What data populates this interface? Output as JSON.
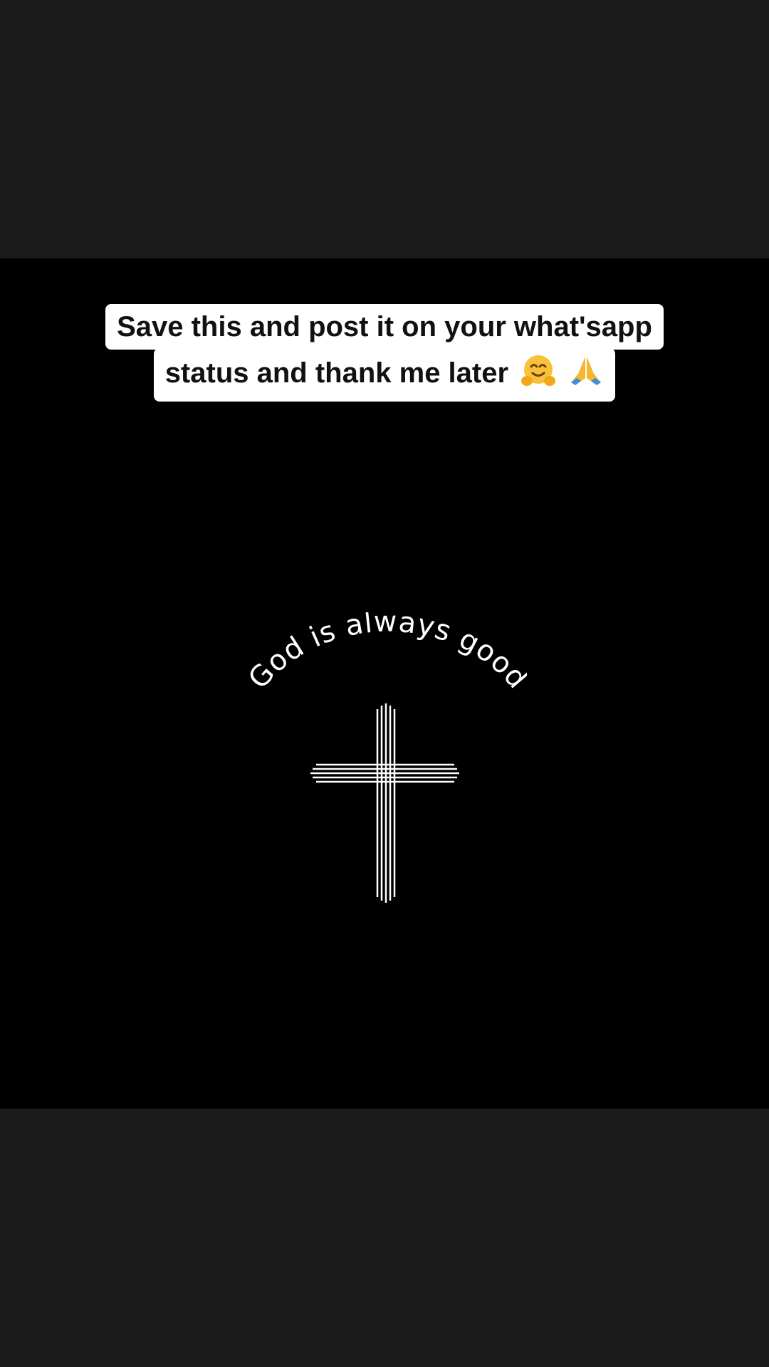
{
  "caption": {
    "line1": "Save this and post it on your what'sapp",
    "line2": "status and thank me later"
  },
  "emojis": [
    "hugging-face-icon",
    "folded-hands-icon"
  ],
  "artwork": {
    "arched_text": "God is always good",
    "icon": "cross-icon"
  },
  "colors": {
    "letterbox": "#1b1b1b",
    "video_background": "#000000",
    "caption_background": "#ffffff",
    "caption_text": "#111111",
    "artwork_foreground": "#ffffff"
  }
}
